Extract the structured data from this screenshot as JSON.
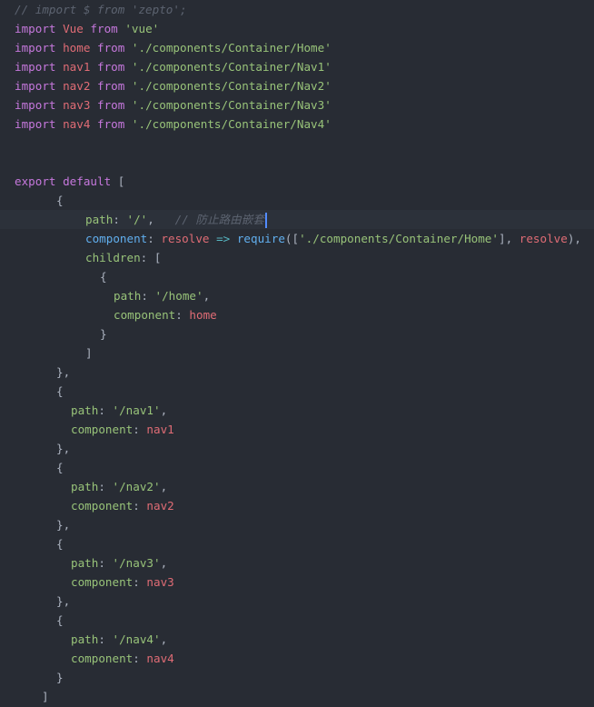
{
  "editor": {
    "lines": [
      {
        "indent": 16,
        "tokens": [
          {
            "t": "comment",
            "v": "// import $ from 'zepto';"
          }
        ]
      },
      {
        "indent": 16,
        "tokens": [
          {
            "t": "kw",
            "v": "import "
          },
          {
            "t": "var",
            "v": "Vue "
          },
          {
            "t": "kw",
            "v": "from "
          },
          {
            "t": "str",
            "v": "'vue'"
          }
        ]
      },
      {
        "indent": 16,
        "tokens": [
          {
            "t": "kw",
            "v": "import "
          },
          {
            "t": "var",
            "v": "home "
          },
          {
            "t": "kw",
            "v": "from "
          },
          {
            "t": "str",
            "v": "'./components/Container/Home'"
          }
        ]
      },
      {
        "indent": 16,
        "tokens": [
          {
            "t": "kw",
            "v": "import "
          },
          {
            "t": "var",
            "v": "nav1 "
          },
          {
            "t": "kw",
            "v": "from "
          },
          {
            "t": "str",
            "v": "'./components/Container/Nav1'"
          }
        ]
      },
      {
        "indent": 16,
        "tokens": [
          {
            "t": "kw",
            "v": "import "
          },
          {
            "t": "var",
            "v": "nav2 "
          },
          {
            "t": "kw",
            "v": "from "
          },
          {
            "t": "str",
            "v": "'./components/Container/Nav2'"
          }
        ]
      },
      {
        "indent": 16,
        "tokens": [
          {
            "t": "kw",
            "v": "import "
          },
          {
            "t": "var",
            "v": "nav3 "
          },
          {
            "t": "kw",
            "v": "from "
          },
          {
            "t": "str",
            "v": "'./components/Container/Nav3'"
          }
        ]
      },
      {
        "indent": 16,
        "tokens": [
          {
            "t": "kw",
            "v": "import "
          },
          {
            "t": "var",
            "v": "nav4 "
          },
          {
            "t": "kw",
            "v": "from "
          },
          {
            "t": "str",
            "v": "'./components/Container/Nav4'"
          }
        ]
      },
      {
        "indent": 16,
        "tokens": []
      },
      {
        "indent": 16,
        "tokens": []
      },
      {
        "indent": 16,
        "tokens": [
          {
            "t": "kw",
            "v": "export default "
          },
          {
            "t": "punc",
            "v": "["
          }
        ]
      },
      {
        "indent": 62,
        "tokens": [
          {
            "t": "punc",
            "v": "{"
          }
        ]
      },
      {
        "indent": 94,
        "active": true,
        "cursor": true,
        "tokens": [
          {
            "t": "prop",
            "v": "path"
          },
          {
            "t": "punc",
            "v": ": "
          },
          {
            "t": "str",
            "v": "'/'"
          },
          {
            "t": "punc",
            "v": ",   "
          },
          {
            "t": "comment",
            "v": "// 防止路由嵌套"
          }
        ]
      },
      {
        "indent": 94,
        "tokens": [
          {
            "t": "prop-blue",
            "v": "component"
          },
          {
            "t": "punc",
            "v": ": "
          },
          {
            "t": "var",
            "v": "resolve "
          },
          {
            "t": "op",
            "v": "=> "
          },
          {
            "t": "fn",
            "v": "require"
          },
          {
            "t": "punc",
            "v": "(["
          },
          {
            "t": "str",
            "v": "'./components/Container/Home'"
          },
          {
            "t": "punc",
            "v": "], "
          },
          {
            "t": "var",
            "v": "resolve"
          },
          {
            "t": "punc",
            "v": "),"
          }
        ]
      },
      {
        "indent": 94,
        "tokens": [
          {
            "t": "prop",
            "v": "children"
          },
          {
            "t": "punc",
            "v": ": ["
          }
        ]
      },
      {
        "indent": 110,
        "tokens": [
          {
            "t": "punc",
            "v": "{"
          }
        ]
      },
      {
        "indent": 125,
        "tokens": [
          {
            "t": "prop",
            "v": "path"
          },
          {
            "t": "punc",
            "v": ": "
          },
          {
            "t": "str",
            "v": "'/home'"
          },
          {
            "t": "punc",
            "v": ","
          }
        ]
      },
      {
        "indent": 125,
        "tokens": [
          {
            "t": "prop",
            "v": "component"
          },
          {
            "t": "punc",
            "v": ": "
          },
          {
            "t": "var",
            "v": "home"
          }
        ]
      },
      {
        "indent": 110,
        "tokens": [
          {
            "t": "punc",
            "v": "}"
          }
        ]
      },
      {
        "indent": 94,
        "tokens": [
          {
            "t": "punc",
            "v": "]"
          }
        ]
      },
      {
        "indent": 62,
        "tokens": [
          {
            "t": "punc",
            "v": "},"
          }
        ]
      },
      {
        "indent": 62,
        "tokens": [
          {
            "t": "punc",
            "v": "{"
          }
        ]
      },
      {
        "indent": 78,
        "tokens": [
          {
            "t": "prop",
            "v": "path"
          },
          {
            "t": "punc",
            "v": ": "
          },
          {
            "t": "str",
            "v": "'/nav1'"
          },
          {
            "t": "punc",
            "v": ","
          }
        ]
      },
      {
        "indent": 78,
        "tokens": [
          {
            "t": "prop",
            "v": "component"
          },
          {
            "t": "punc",
            "v": ": "
          },
          {
            "t": "var",
            "v": "nav1"
          }
        ]
      },
      {
        "indent": 62,
        "tokens": [
          {
            "t": "punc",
            "v": "},"
          }
        ]
      },
      {
        "indent": 62,
        "tokens": [
          {
            "t": "punc",
            "v": "{"
          }
        ]
      },
      {
        "indent": 78,
        "tokens": [
          {
            "t": "prop",
            "v": "path"
          },
          {
            "t": "punc",
            "v": ": "
          },
          {
            "t": "str",
            "v": "'/nav2'"
          },
          {
            "t": "punc",
            "v": ","
          }
        ]
      },
      {
        "indent": 78,
        "tokens": [
          {
            "t": "prop",
            "v": "component"
          },
          {
            "t": "punc",
            "v": ": "
          },
          {
            "t": "var",
            "v": "nav2"
          }
        ]
      },
      {
        "indent": 62,
        "tokens": [
          {
            "t": "punc",
            "v": "},"
          }
        ]
      },
      {
        "indent": 62,
        "tokens": [
          {
            "t": "punc",
            "v": "{"
          }
        ]
      },
      {
        "indent": 78,
        "tokens": [
          {
            "t": "prop",
            "v": "path"
          },
          {
            "t": "punc",
            "v": ": "
          },
          {
            "t": "str",
            "v": "'/nav3'"
          },
          {
            "t": "punc",
            "v": ","
          }
        ]
      },
      {
        "indent": 78,
        "tokens": [
          {
            "t": "prop",
            "v": "component"
          },
          {
            "t": "punc",
            "v": ": "
          },
          {
            "t": "var",
            "v": "nav3"
          }
        ]
      },
      {
        "indent": 62,
        "tokens": [
          {
            "t": "punc",
            "v": "},"
          }
        ]
      },
      {
        "indent": 62,
        "tokens": [
          {
            "t": "punc",
            "v": "{"
          }
        ]
      },
      {
        "indent": 78,
        "tokens": [
          {
            "t": "prop",
            "v": "path"
          },
          {
            "t": "punc",
            "v": ": "
          },
          {
            "t": "str",
            "v": "'/nav4'"
          },
          {
            "t": "punc",
            "v": ","
          }
        ]
      },
      {
        "indent": 78,
        "tokens": [
          {
            "t": "prop",
            "v": "component"
          },
          {
            "t": "punc",
            "v": ": "
          },
          {
            "t": "var",
            "v": "nav4"
          }
        ]
      },
      {
        "indent": 62,
        "tokens": [
          {
            "t": "punc",
            "v": "}"
          }
        ]
      },
      {
        "indent": 46,
        "tokens": [
          {
            "t": "punc",
            "v": "]"
          }
        ]
      }
    ]
  },
  "theme": {
    "background": "#282c34",
    "active_line": "#2c313a",
    "comment": "#5c6370",
    "keyword": "#c678dd",
    "variable": "#e06c75",
    "string": "#98c379",
    "punctuation": "#abb2bf",
    "property_blue": "#61afef",
    "operator": "#56b6c2",
    "cursor": "#528bff"
  }
}
